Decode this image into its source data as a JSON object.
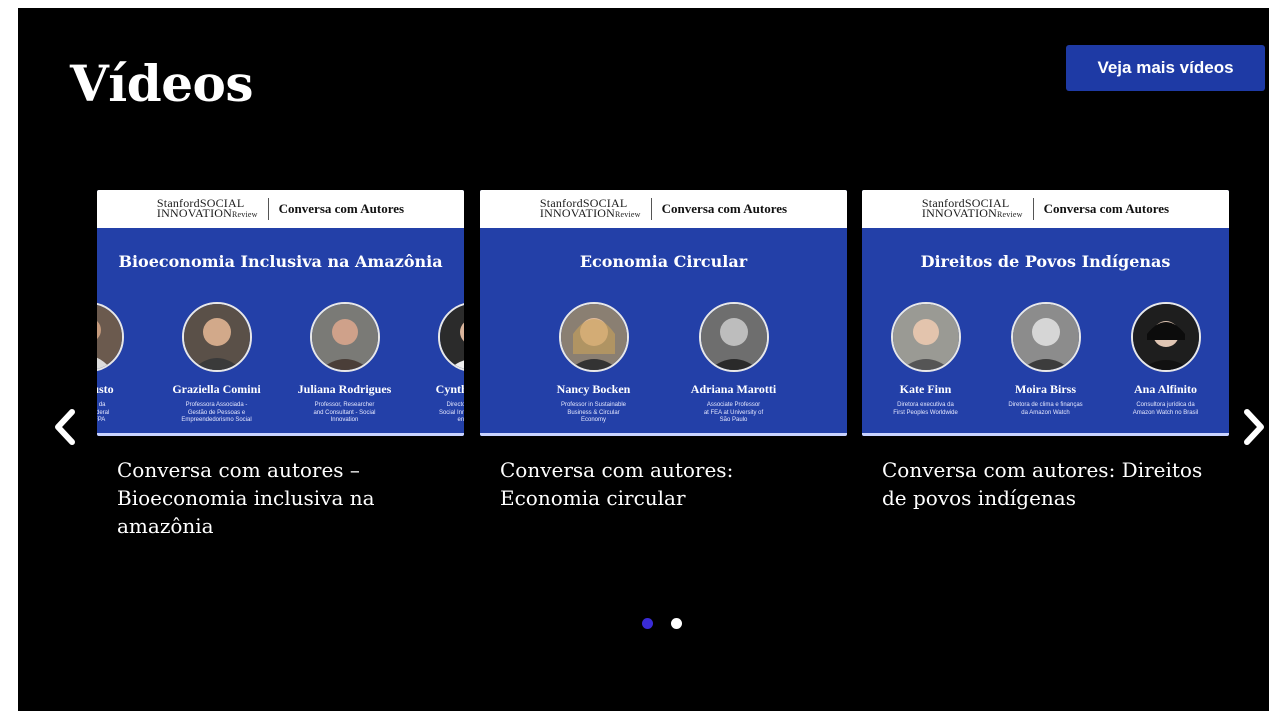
{
  "section": {
    "title": "Vídeos",
    "more_button": "Veja mais vídeos"
  },
  "carousel": {
    "prev_icon": "chevron-left-icon",
    "next_icon": "chevron-right-icon",
    "cards": [
      {
        "header_logo_line1": "StanfordSOCIAL",
        "header_logo_line2": "INNOVATION",
        "header_logo_review": "Review",
        "header_series": "Conversa com Autores",
        "thumb_title": "Bioeconomia Inclusiva na Amazônia",
        "people": [
          {
            "name": "é Augusto",
            "role": "Professor da\nrsidade Federal\nPará - UFPA"
          },
          {
            "name": "Graziella Comini",
            "role": "Professora Associada -\nGestão de Pessoas e\nEmpreendedorismo Social"
          },
          {
            "name": "Juliana Rodrigues",
            "role": "Professor, Researcher\nand Consultant - Social\nInnovation"
          },
          {
            "name": "Cynthia Villar",
            "role": "Director of Stanford\nSocial Innovation Review\nen Español"
          }
        ],
        "title": "Conversa com autores – Bioeconomia inclusiva na amazônia"
      },
      {
        "header_logo_line1": "StanfordSOCIAL",
        "header_logo_line2": "INNOVATION",
        "header_logo_review": "Review",
        "header_series": "Conversa com Autores",
        "thumb_title": "Economia Circular",
        "people": [
          {
            "name": "Nancy Bocken",
            "role": "Professor in Sustainable\nBusiness & Circular\nEconomy"
          },
          {
            "name": "Adriana Marotti",
            "role": "Associate Professor\nat FEA at University of\nSão Paulo"
          }
        ],
        "title": "Conversa com autores: Economia circular"
      },
      {
        "header_logo_line1": "StanfordSOCIAL",
        "header_logo_line2": "INNOVATION",
        "header_logo_review": "Review",
        "header_series": "Conversa com Autores",
        "thumb_title": "Direitos de Povos Indígenas",
        "people": [
          {
            "name": "Kate Finn",
            "role": "Diretora executiva da\nFirst Peoples Worldwide"
          },
          {
            "name": "Moira Birss",
            "role": "Diretora de clima e finanças\nda Amazon Watch"
          },
          {
            "name": "Ana Alfinito",
            "role": "Consultora jurídica da\nAmazon Watch no Brasil"
          }
        ],
        "title": "Conversa com autores: Direitos de povos indígenas"
      }
    ],
    "pagination": {
      "active_color": "#3a2bd6",
      "inactive_color": "#ffffff",
      "active_index": 0,
      "page_count": 2
    }
  },
  "colors": {
    "background": "#000000",
    "accent_button": "#1e3aa5",
    "thumbnail_blue": "#2340a8"
  }
}
